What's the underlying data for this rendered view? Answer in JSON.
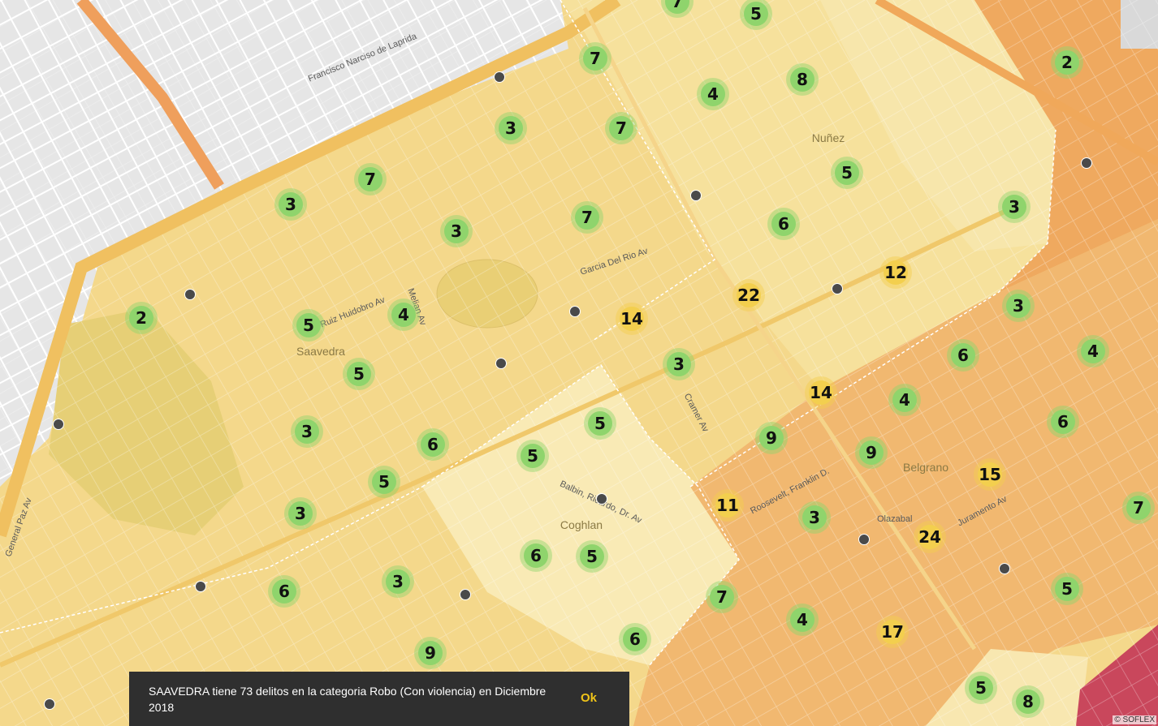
{
  "map": {
    "place_labels": [
      "Saavedra",
      "Coghlan",
      "Belgrano",
      "Nuñez"
    ],
    "street_labels": [
      "Francisco Narciso de Laprida",
      "General Paz Av",
      "Ruiz Huidobro Av",
      "Balbin, Ricardo, Dr. Av",
      "Garcia Del Rio Av",
      "Cramer Av",
      "Melian Av",
      "Roosevelt, Franklin D.",
      "Juramento Av",
      "Olazabal"
    ],
    "attribution": "© SOFLEX",
    "colors": {
      "green_marker": "#8fd46c",
      "yellow_marker": "#f3cf4e",
      "zone_light": "#f6e3a2",
      "zone_orange": "#f1b36c",
      "zone_red": "#c9475c",
      "city_grid": "#e8e8e8"
    }
  },
  "markers": [
    {
      "v": "7",
      "c": "green"
    },
    {
      "v": "5",
      "c": "green"
    },
    {
      "v": "2",
      "c": "green"
    },
    {
      "v": "7",
      "c": "green"
    },
    {
      "v": "8",
      "c": "green"
    },
    {
      "v": "4",
      "c": "green"
    },
    {
      "v": "3",
      "c": "green"
    },
    {
      "v": "7",
      "c": "green"
    },
    {
      "v": "5",
      "c": "green"
    },
    {
      "v": "7",
      "c": "green"
    },
    {
      "v": "3",
      "c": "green"
    },
    {
      "v": "6",
      "c": "green"
    },
    {
      "v": "3",
      "c": "green"
    },
    {
      "v": "7",
      "c": "green"
    },
    {
      "v": "3",
      "c": "green"
    },
    {
      "v": "12",
      "c": "yellow"
    },
    {
      "v": "22",
      "c": "yellow"
    },
    {
      "v": "2",
      "c": "green"
    },
    {
      "v": "4",
      "c": "green"
    },
    {
      "v": "14",
      "c": "yellow"
    },
    {
      "v": "5",
      "c": "green"
    },
    {
      "v": "3",
      "c": "green"
    },
    {
      "v": "3",
      "c": "green"
    },
    {
      "v": "6",
      "c": "green"
    },
    {
      "v": "4",
      "c": "green"
    },
    {
      "v": "5",
      "c": "green"
    },
    {
      "v": "14",
      "c": "yellow"
    },
    {
      "v": "4",
      "c": "green"
    },
    {
      "v": "6",
      "c": "green"
    },
    {
      "v": "5",
      "c": "green"
    },
    {
      "v": "3",
      "c": "green"
    },
    {
      "v": "9",
      "c": "green"
    },
    {
      "v": "6",
      "c": "green"
    },
    {
      "v": "5",
      "c": "green"
    },
    {
      "v": "9",
      "c": "green"
    },
    {
      "v": "15",
      "c": "yellow"
    },
    {
      "v": "5",
      "c": "green"
    },
    {
      "v": "3",
      "c": "green"
    },
    {
      "v": "11",
      "c": "yellow"
    },
    {
      "v": "7",
      "c": "green"
    },
    {
      "v": "3",
      "c": "green"
    },
    {
      "v": "24",
      "c": "yellow"
    },
    {
      "v": "6",
      "c": "green"
    },
    {
      "v": "5",
      "c": "green"
    },
    {
      "v": "6",
      "c": "green"
    },
    {
      "v": "3",
      "c": "green"
    },
    {
      "v": "7",
      "c": "green"
    },
    {
      "v": "5",
      "c": "green"
    },
    {
      "v": "4",
      "c": "green"
    },
    {
      "v": "17",
      "c": "yellow"
    },
    {
      "v": "6",
      "c": "green"
    },
    {
      "v": "9",
      "c": "green"
    },
    {
      "v": "5",
      "c": "green"
    },
    {
      "v": "8",
      "c": "green"
    }
  ],
  "toast": {
    "message": "SAAVEDRA tiene 73 delitos en la categoria Robo (Con violencia) en Diciembre 2018",
    "ok_label": "Ok"
  }
}
